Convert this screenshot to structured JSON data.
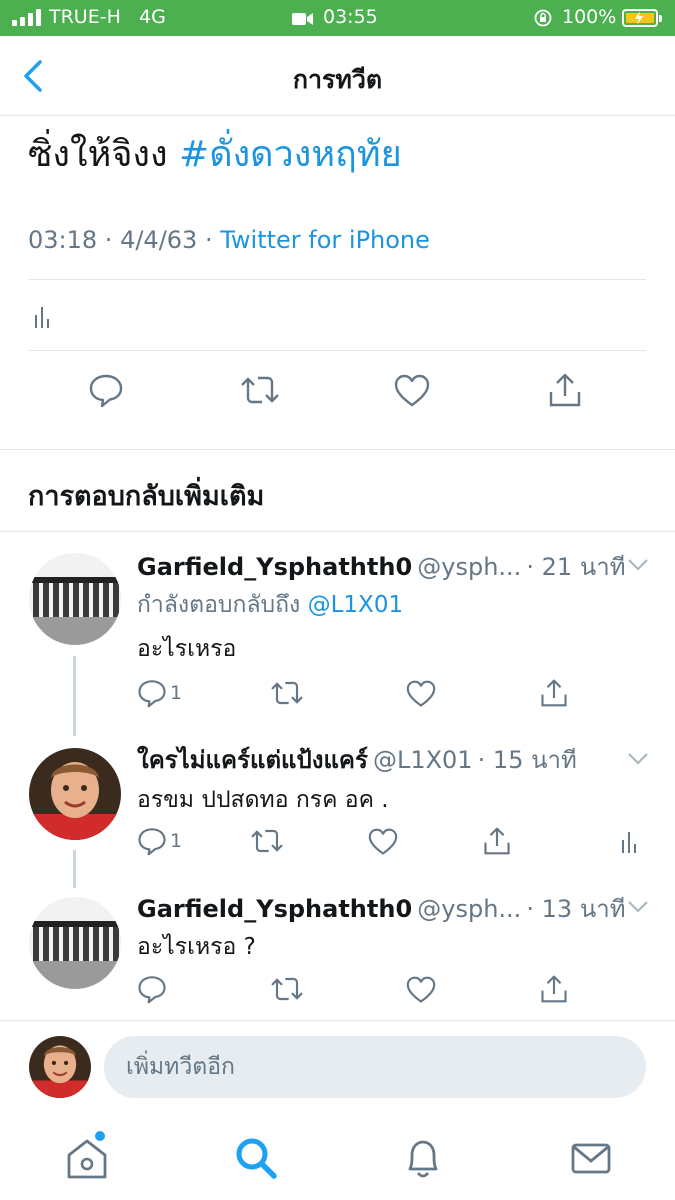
{
  "status_bar": {
    "carrier": "TRUE-H",
    "network": "4G",
    "time": "03:55",
    "battery": "100%",
    "colors": {
      "background": "#4caf50",
      "battery_fill": "#f5c518"
    }
  },
  "header": {
    "title": "การทวีต"
  },
  "tweet": {
    "text": "ซิ่งให้จิงง",
    "hashtag": "#ดั่งดวงหฤทัย",
    "time": "03:18",
    "date": "4/4/63",
    "source": "Twitter for iPhone",
    "actions": [
      "reply-icon",
      "retweet-icon",
      "like-icon",
      "share-icon"
    ]
  },
  "replies_section": {
    "title": "การตอบกลับเพิ่มเติม"
  },
  "replies": [
    {
      "name": "Garfield_Ysphathth0",
      "handle": "@ysph...",
      "time": "· 21 นาที",
      "replying_to_label": "กำลังตอบกลับถึง",
      "replying_to": "@L1X01",
      "text": "อะไรเหรอ",
      "reply_count": "1"
    },
    {
      "name": "ใครไม่แคร์แต่แป้งแคร์",
      "handle": "@L1X01",
      "time": "· 15 นาที",
      "text": "อรขม ปปสดทอ กรค อค .",
      "reply_count": "1"
    },
    {
      "name": "Garfield_Ysphathth0",
      "handle": "@ysph...",
      "time": "· 13 นาที",
      "text": "อะไรเหรอ ?",
      "reply_count": ""
    }
  ],
  "compose": {
    "placeholder": "เพิ่มทวีตอีก"
  },
  "tabs": [
    "home-icon",
    "search-icon",
    "notifications-icon",
    "messages-icon"
  ],
  "colors": {
    "accent": "#1da1f2",
    "link": "#1b95e0",
    "muted": "#657786",
    "divider": "#e1e8ed"
  }
}
